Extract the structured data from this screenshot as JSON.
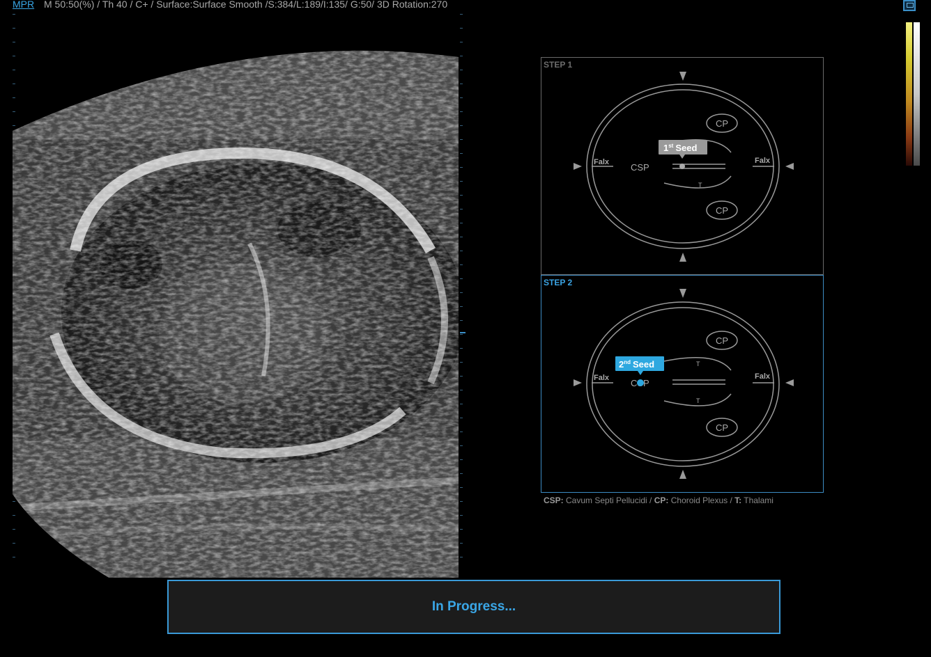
{
  "header": {
    "mode_label": "MPR",
    "params": "M 50:50(%) / Th 40 / C+ / Surface:Surface Smooth /S:384/L:189/I:135/ G:50/ 3D Rotation:270",
    "save_icon": "save-disk-icon"
  },
  "step1": {
    "label": "STEP 1",
    "seed_label": "1",
    "seed_sup": "st",
    "seed_word": "Seed",
    "csp": "CSP",
    "cp_top": "CP",
    "cp_bottom": "CP",
    "falx_left": "Falx",
    "falx_right": "Falx",
    "thalamus": "T"
  },
  "step2": {
    "label": "STEP 2",
    "seed_label": "2",
    "seed_sup": "nd",
    "seed_word": "Seed",
    "csp": "CSP",
    "cp_top": "CP",
    "cp_bottom": "CP",
    "falx_left": "Falx",
    "falx_right": "Falx",
    "thalamus_top": "T",
    "thalamus_bottom": "T"
  },
  "legend": {
    "csp_abbr": "CSP:",
    "csp_text": " Cavum Septi Pellucidi  / ",
    "cp_abbr": "CP:",
    "cp_text": " Choroid Plexus  / ",
    "t_abbr": "T:",
    "t_text": " Thalami"
  },
  "progress": {
    "text": "In Progress..."
  },
  "colors": {
    "accent": "#3aa6e6",
    "panel_border": "#6a6a6a",
    "seed_active": "#2ea8e0",
    "seed_inactive": "#9a9a9a"
  }
}
